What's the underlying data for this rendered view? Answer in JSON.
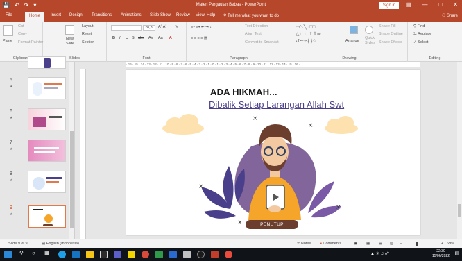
{
  "titlebar": {
    "document_title": "Materi Pergaulan Bebas - PowerPoint",
    "signin_label": "Sign in",
    "qat": {
      "save_icon": "save-icon",
      "undo_icon": "undo-icon",
      "redo_icon": "redo-icon"
    }
  },
  "tabs": [
    {
      "label": "File"
    },
    {
      "label": "Home"
    },
    {
      "label": "Insert"
    },
    {
      "label": "Design"
    },
    {
      "label": "Transitions"
    },
    {
      "label": "Animations"
    },
    {
      "label": "Slide Show"
    },
    {
      "label": "Review"
    },
    {
      "label": "View"
    },
    {
      "label": "Help"
    }
  ],
  "tell_me": "Tell me what you want to do",
  "share_label": "Share",
  "ribbon": {
    "clipboard": {
      "paste": "Paste",
      "cut": "Cut",
      "copy": "Copy",
      "format_painter": "Format Painter",
      "group": "Clipboard"
    },
    "slides": {
      "new_slide": "New",
      "new_slide2": "Slide",
      "layout": "Layout",
      "reset": "Reset",
      "section": "Section",
      "group": "Slides"
    },
    "font": {
      "size": "28,3",
      "group": "Font"
    },
    "paragraph": {
      "text_direction": "Text Direction",
      "align_text": "Align Text",
      "smartart": "Convert to SmartArt",
      "group": "Paragraph"
    },
    "drawing": {
      "arrange": "Arrange",
      "quick_styles": "Quick",
      "quick_styles2": "Styles",
      "shape_fill": "Shape Fill",
      "shape_outline": "Shape Outline",
      "shape_effects": "Shape Effects",
      "group": "Drawing"
    },
    "editing": {
      "find": "Find",
      "replace": "Replace",
      "select": "Select",
      "group": "Editing"
    }
  },
  "thumbnails": [
    {
      "num": "5"
    },
    {
      "num": "6"
    },
    {
      "num": "7"
    },
    {
      "num": "8"
    },
    {
      "num": "9"
    }
  ],
  "ruler_text": "· 16 · 15 · 14 · 13 · 12 · 11 · 10 · 9 · 8 · 7 · 6 · 5 · 4 · 3 · 2 · 1 · 0 · 1 · 2 · 3 · 4 · 5 · 6 · 7 · 8 · 9 · 10 · 11 · 12 · 13 · 14 · 15 · 16 ·",
  "slide": {
    "title": "ADA HIKMAH...",
    "subtitle": "Dibalik Setiap Larangan Allah Swt",
    "button_label": "PENUTUP",
    "colors": {
      "shirt": "#f4a52a",
      "hair": "#6b3e2e",
      "leaves": "#4a3f8a",
      "blob": "#6b4a8a",
      "cloud": "#fde2b0"
    }
  },
  "statusbar": {
    "slide_info": "Slide 9 of 9",
    "language": "English (Indonesia)",
    "notes": "Notes",
    "comments": "Comments",
    "zoom": "69%"
  },
  "taskbar": {
    "time": "22:30",
    "date": "15/06/2022"
  }
}
